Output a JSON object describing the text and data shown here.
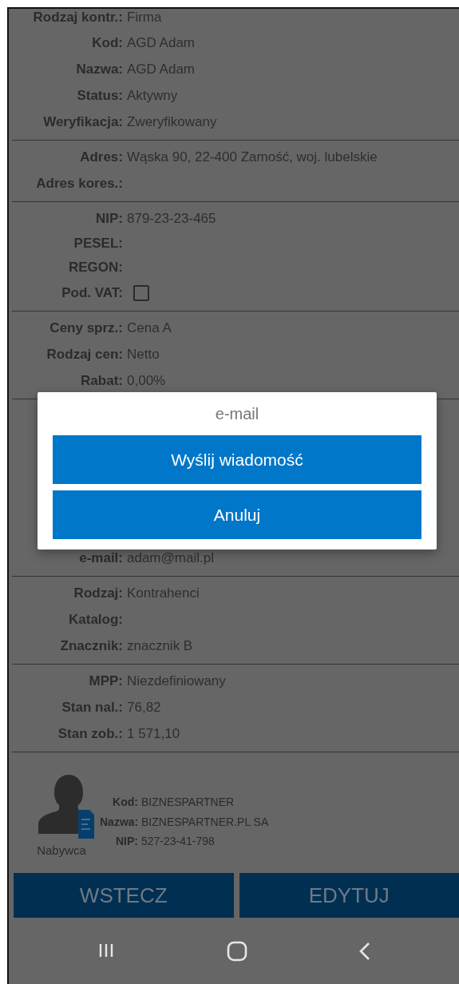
{
  "sections": [
    {
      "kind": "info",
      "rows": [
        {
          "kind": "text",
          "label": "Rodzaj kontr.:",
          "value": "Firma"
        },
        {
          "kind": "text",
          "label": "Kod:",
          "value": "AGD Adam"
        },
        {
          "kind": "text",
          "label": "Nazwa:",
          "value": "AGD Adam"
        },
        {
          "kind": "text",
          "label": "Status:",
          "value": "Aktywny"
        },
        {
          "kind": "text",
          "label": "Weryfikacja:",
          "value": "Zweryfikowany"
        }
      ]
    },
    {
      "kind": "info",
      "rows": [
        {
          "kind": "text",
          "label": "Adres:",
          "value": "Wąska 90, 22-400 Zamość, woj. lubelskie"
        },
        {
          "kind": "text",
          "label": "Adres kores.:"
        }
      ]
    },
    {
      "kind": "info",
      "rows": [
        {
          "kind": "text",
          "label": "NIP:",
          "value": "879-23-23-465"
        },
        {
          "kind": "text",
          "label": "PESEL:"
        },
        {
          "kind": "text",
          "label": "REGON:"
        },
        {
          "kind": "checkbox",
          "label": "Pod. VAT:",
          "checked": false
        }
      ]
    },
    {
      "kind": "info",
      "rows": [
        {
          "kind": "text",
          "label": "Ceny sprz.:",
          "value": "Cena A"
        },
        {
          "kind": "text",
          "label": "Rodzaj cen:",
          "value": "Netto"
        },
        {
          "kind": "text",
          "label": "Rabat:",
          "value": "0,00%"
        }
      ]
    },
    {
      "kind": "contact",
      "rows": [
        {
          "kind": "text",
          "label": "e-mail:",
          "value": "adam@mail.pl"
        }
      ]
    },
    {
      "kind": "info",
      "rows": [
        {
          "kind": "text",
          "label": "Rodzaj:",
          "value": "Kontrahenci"
        },
        {
          "kind": "text",
          "label": "Katalog:"
        },
        {
          "kind": "text",
          "label": "Znacznik:",
          "value": "znacznik B"
        }
      ]
    },
    {
      "kind": "info",
      "rows": [
        {
          "kind": "text",
          "label": "MPP:",
          "value": "Niezdefiniowany"
        },
        {
          "kind": "text",
          "label": "Stan nal.:",
          "value": "76,82"
        },
        {
          "kind": "text",
          "label": "Stan zob.:",
          "value": "1 571,10"
        }
      ]
    }
  ],
  "partner": {
    "caption": "Nabywca",
    "fields": [
      {
        "label": "Kod:",
        "value": "BIZNESPARTNER"
      },
      {
        "label": "Nazwa:",
        "value": "BIZNESPARTNER.PL SA"
      },
      {
        "label": "NIP:",
        "value": "527-23-41-798"
      }
    ]
  },
  "bottom_buttons": [
    "WSTECZ",
    "EDYTUJ"
  ],
  "dialog": {
    "title": "e-mail",
    "buttons": [
      "Wyślij wiadomość",
      "Anuluj"
    ]
  }
}
